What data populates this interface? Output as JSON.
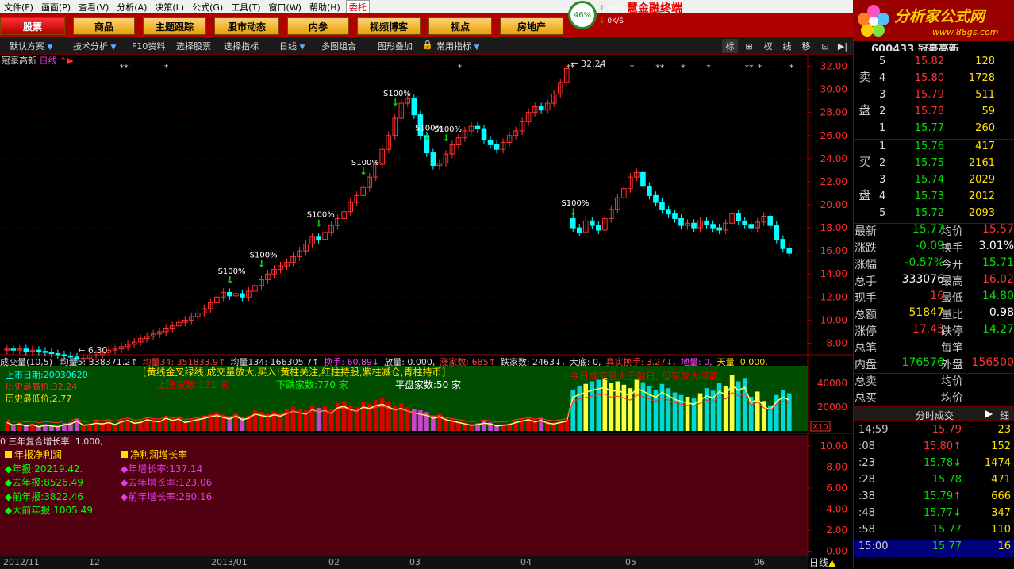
{
  "menu": [
    "文件(F)",
    "画面(P)",
    "查看(V)",
    "分析(A)",
    "决策(L)",
    "公式(G)",
    "工具(T)",
    "窗口(W)",
    "帮助(H)"
  ],
  "weituo": "委托",
  "brand_title": "慧金融终端",
  "toolbar_buttons": [
    "股票",
    "商品",
    "主题跟踪",
    "股市动态",
    "内参",
    "视频博客",
    "视点",
    "房地产"
  ],
  "speed": {
    "percent": "46%",
    "up": "0K/S",
    "down": "0K/S"
  },
  "logo": {
    "text": "分析家公式网",
    "url": "www.88gs.com"
  },
  "toolbar2": {
    "items": [
      "默认方案",
      "技术分析",
      "F10资料",
      "选择股票",
      "选择指标",
      "日线",
      "多图组合",
      "图形叠加",
      "常用指标"
    ],
    "right": [
      "标",
      "⊞",
      "权",
      "线",
      "移",
      "⊡",
      "▶|"
    ]
  },
  "stock": {
    "name": "冠豪高新",
    "period": "日线",
    "code_line": "600433 冠豪高新"
  },
  "price_axis": [
    "32.00",
    "30.00",
    "28.00",
    "26.00",
    "24.00",
    "22.00",
    "20.00",
    "18.00",
    "16.00",
    "14.00",
    "12.00",
    "10.00",
    "8.00"
  ],
  "chart_marks": {
    "high": "32.24",
    "low": "6.30",
    "signal": "S100%"
  },
  "volume_header": {
    "label": "成交量(10,5)",
    "items": [
      {
        "t": "均量5: 338371.2↑",
        "c": "#ddd"
      },
      {
        "t": "均量34: 351833.9↑",
        "c": "#ff4040"
      },
      {
        "t": "均量134: 166305.7↑",
        "c": "#ddd"
      },
      {
        "t": "换手: 60.89↓",
        "c": "#ff40ff"
      },
      {
        "t": "放量: 0.000,",
        "c": "#ddd"
      },
      {
        "t": "涨家数: 685↑",
        "c": "#ff4040"
      },
      {
        "t": "跌家数: 2463↓,",
        "c": "#ddd"
      },
      {
        "t": "大底: 0,",
        "c": "#ddd"
      },
      {
        "t": "真实换手: 3.27↓,",
        "c": "#ff4040"
      },
      {
        "t": "地量: 0,",
        "c": "#ff40ff"
      },
      {
        "t": "天量: 0.000,",
        "c": "#ffe000"
      }
    ]
  },
  "volume_axis": [
    "40000",
    "20000"
  ],
  "volume_unit": "X10",
  "info": {
    "listing": "上市日期:20030620",
    "hist_high": "历史最高价:32.24",
    "hist_low": "历史最低价:2.77",
    "banner": "[黄线金叉绿线,成交量放大,买入!黄柱关注,红柱持股,紫柱减仓,青柱持币]",
    "up_count": "上涨家数:121 家",
    "down_count": "下跌家数:770 家",
    "flat_count": "平盘家数:50 家",
    "today": "今日成交量大于前日, 但有放大可能"
  },
  "financial": {
    "header": "0  三年复合增长率: 1.000,",
    "left_title": "年报净利润",
    "right_title": "净利润增长率",
    "left": [
      "年报:20219.42.",
      "去年报:8526.49",
      "前年报:3822.46",
      "大前年报:1005.49"
    ],
    "right": [
      "年增长率:137.14",
      "去年增长率:123.06",
      "前年增长率:280.16"
    ]
  },
  "fin_axis": [
    "10.00",
    "8.00",
    "6.00",
    "4.00",
    "2.00",
    "0.00"
  ],
  "date_axis": [
    "2012/11",
    "12",
    "2013/01",
    "02",
    "03",
    "04",
    "05",
    "06"
  ],
  "daily_tab": "日线",
  "orderbook": {
    "sell_label": [
      "卖",
      "盘"
    ],
    "buy_label": [
      "买",
      "盘"
    ],
    "sell": [
      {
        "i": "5",
        "p": "15.82",
        "v": "128",
        "c": "red"
      },
      {
        "i": "4",
        "p": "15.80",
        "v": "1728",
        "c": "red"
      },
      {
        "i": "3",
        "p": "15.79",
        "v": "511",
        "c": "red"
      },
      {
        "i": "2",
        "p": "15.78",
        "v": "59",
        "c": "red"
      },
      {
        "i": "1",
        "p": "15.77",
        "v": "260",
        "c": "green"
      }
    ],
    "buy": [
      {
        "i": "1",
        "p": "15.76",
        "v": "417",
        "c": "green"
      },
      {
        "i": "2",
        "p": "15.75",
        "v": "2161",
        "c": "green"
      },
      {
        "i": "3",
        "p": "15.74",
        "v": "2029",
        "c": "green"
      },
      {
        "i": "4",
        "p": "15.73",
        "v": "2012",
        "c": "green"
      },
      {
        "i": "5",
        "p": "15.72",
        "v": "2093",
        "c": "green"
      }
    ]
  },
  "quote": [
    {
      "l": "最新",
      "lv": "15.77",
      "lc": "green",
      "r": "均价",
      "rv": "15.57",
      "rc": "red"
    },
    {
      "l": "涨跌",
      "lv": "-0.09",
      "lc": "green",
      "r": "换手",
      "rv": "3.01%",
      "rc": "white"
    },
    {
      "l": "涨幅",
      "lv": "-0.57%",
      "lc": "green",
      "r": "今开",
      "rv": "15.71",
      "rc": "green"
    },
    {
      "l": "总手",
      "lv": "333076",
      "lc": "white",
      "r": "最高",
      "rv": "16.02",
      "rc": "red"
    },
    {
      "l": "现手",
      "lv": "16",
      "lc": "red",
      "r": "最低",
      "rv": "14.80",
      "rc": "green"
    },
    {
      "l": "总额",
      "lv": "51847",
      "lc": "yellow",
      "r": "量比",
      "rv": "0.98",
      "rc": "white"
    },
    {
      "l": "涨停",
      "lv": "17.45",
      "lc": "red",
      "r": "跌停",
      "rv": "14.27",
      "rc": "green"
    },
    {
      "l": "总笔",
      "lv": "",
      "lc": "white",
      "r": "每笔",
      "rv": "",
      "rc": "white"
    },
    {
      "l": "内盘",
      "lv": "176576",
      "lc": "green",
      "r": "外盘",
      "rv": "156500",
      "rc": "red"
    },
    {
      "l": "总卖",
      "lv": "",
      "lc": "white",
      "r": "均价",
      "rv": "",
      "rc": "white"
    },
    {
      "l": "总买",
      "lv": "",
      "lc": "white",
      "r": "均价",
      "rv": "",
      "rc": "white"
    }
  ],
  "ticks_header": {
    "title": "分时成交",
    "detail": "细"
  },
  "ticks": [
    {
      "t": "14:59",
      "p": "15.79",
      "a": "",
      "v": "23",
      "c": "red"
    },
    {
      "t": ":08",
      "p": "15.80",
      "a": "↑",
      "v": "152",
      "c": "red"
    },
    {
      "t": ":23",
      "p": "15.78",
      "a": "↓",
      "v": "1474",
      "c": "green"
    },
    {
      "t": ":28",
      "p": "15.78",
      "a": "",
      "v": "471",
      "c": "green"
    },
    {
      "t": ":38",
      "p": "15.79",
      "a": "↑",
      "v": "666",
      "c": "green"
    },
    {
      "t": ":48",
      "p": "15.77",
      "a": "↓",
      "v": "347",
      "c": "green"
    },
    {
      "t": ":58",
      "p": "15.77",
      "a": "",
      "v": "110",
      "c": "green"
    },
    {
      "t": "15:00",
      "p": "15.77",
      "a": "",
      "v": "16",
      "c": "green"
    }
  ],
  "colors": {
    "bg": "#000000",
    "up": "#ff3333",
    "down": "#00ffff",
    "grid": "#660000",
    "panel_bg": "#9b0000"
  },
  "chart_data": {
    "type": "candlestick",
    "price_ylim": [
      7.0,
      33.0
    ],
    "closes": [
      7.5,
      7.4,
      7.5,
      7.3,
      7.4,
      7.3,
      7.2,
      7.1,
      7.0,
      6.9,
      6.8,
      6.6,
      6.7,
      6.9,
      7.0,
      7.2,
      7.4,
      7.5,
      7.7,
      7.9,
      8.1,
      8.4,
      8.6,
      8.8,
      9.0,
      9.3,
      9.5,
      9.8,
      10.0,
      10.3,
      10.6,
      11.0,
      11.5,
      12.0,
      12.4,
      12.1,
      12.3,
      12.0,
      12.5,
      13.0,
      13.5,
      14.0,
      14.4,
      14.7,
      15.0,
      15.5,
      16.0,
      16.6,
      17.2,
      17.0,
      17.6,
      18.2,
      18.8,
      19.4,
      20.2,
      20.8,
      21.5,
      22.4,
      23.5,
      24.8,
      26.0,
      27.5,
      28.8,
      29.2,
      27.8,
      26.0,
      24.5,
      23.4,
      23.6,
      24.4,
      25.2,
      25.8,
      26.4,
      26.8,
      26.6,
      25.6,
      25.2,
      24.8,
      25.4,
      26.0,
      26.4,
      27.2,
      28.0,
      28.5,
      28.2,
      28.8,
      29.6,
      30.6,
      31.8,
      18.0,
      17.6,
      18.6,
      18.2,
      17.8,
      18.8,
      19.6,
      20.6,
      21.4,
      22.4,
      22.8,
      21.6,
      20.8,
      20.2,
      19.6,
      19.2,
      18.8,
      18.2,
      18.4,
      18.0,
      18.6,
      18.3,
      18.0,
      17.8,
      18.4,
      19.2,
      18.6,
      18.3,
      18.0,
      18.5,
      19.0,
      18.2,
      17.0,
      16.2,
      15.8
    ],
    "volumes": [
      12,
      8,
      10,
      7,
      9,
      6,
      8,
      7,
      6,
      9,
      10,
      14,
      8,
      9,
      11,
      10,
      12,
      9,
      13,
      15,
      11,
      12,
      16,
      14,
      13,
      18,
      15,
      17,
      12,
      14,
      16,
      18,
      20,
      22,
      19,
      17,
      21,
      16,
      18,
      24,
      22,
      20,
      23,
      21,
      25,
      28,
      26,
      24,
      30,
      27,
      29,
      25,
      33,
      35,
      30,
      28,
      34,
      32,
      36,
      38,
      34,
      30,
      32,
      28,
      26,
      24,
      22,
      18,
      20,
      16,
      14,
      12,
      10,
      8,
      9,
      11,
      10,
      7,
      8,
      9,
      12,
      14,
      16,
      13,
      15,
      11,
      10,
      12,
      14,
      48,
      52,
      55,
      58,
      60,
      62,
      56,
      58,
      54,
      50,
      60,
      57,
      52,
      48,
      55,
      50,
      45,
      42,
      40,
      38,
      44,
      50,
      47,
      56,
      52,
      65,
      58,
      62,
      40,
      46,
      35,
      30,
      42,
      48,
      44
    ]
  }
}
